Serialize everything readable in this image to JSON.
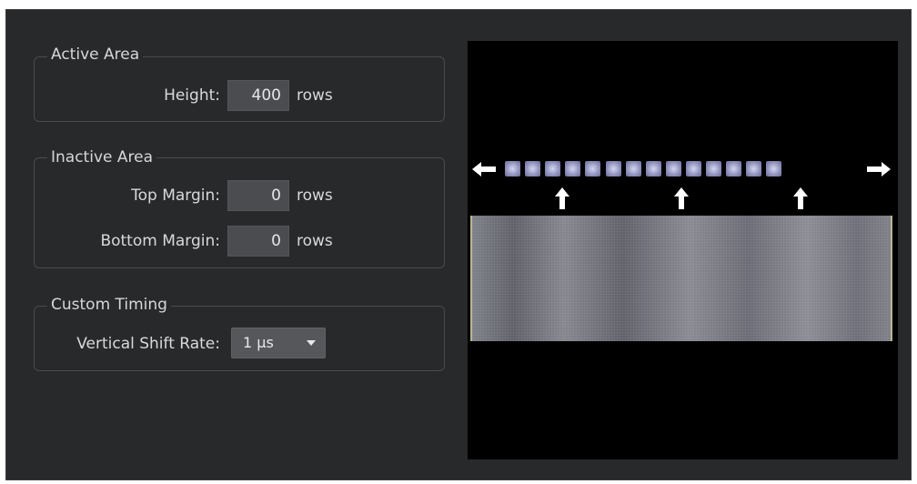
{
  "active_area": {
    "title": "Active Area",
    "height_label": "Height:",
    "height_value": "400",
    "height_unit": "rows"
  },
  "inactive_area": {
    "title": "Inactive Area",
    "top_margin_label": "Top Margin:",
    "top_margin_value": "0",
    "top_margin_unit": "rows",
    "bottom_margin_label": "Bottom Margin:",
    "bottom_margin_value": "0",
    "bottom_margin_unit": "rows"
  },
  "custom_timing": {
    "title": "Custom Timing",
    "vertical_shift_rate_label": "Vertical Shift Rate:",
    "vertical_shift_rate_value": "1 µs"
  },
  "preview": {
    "readout_pixel_count": 14,
    "shift_arrow_count": 3,
    "icons": [
      "arrow-left-icon",
      "arrow-right-icon",
      "arrow-up-icon"
    ]
  }
}
